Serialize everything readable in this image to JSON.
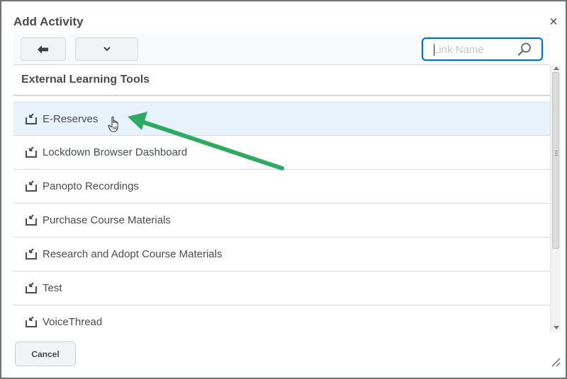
{
  "dialog": {
    "title": "Add Activity",
    "close_label": "×"
  },
  "toolbar": {
    "back_icon": "arrow-left-icon",
    "menu_icon": "chevron-down-icon",
    "search": {
      "placeholder": "Link Name",
      "value": "",
      "icon": "search-icon"
    }
  },
  "section": {
    "title": "External Learning Tools"
  },
  "items": [
    {
      "label": "E-Reserves",
      "icon": "external-link-icon",
      "selected": true
    },
    {
      "label": "Lockdown Browser Dashboard",
      "icon": "external-link-icon"
    },
    {
      "label": "Panopto Recordings",
      "icon": "external-link-icon"
    },
    {
      "label": "Purchase Course Materials",
      "icon": "external-link-icon"
    },
    {
      "label": "Research and Adopt Course Materials",
      "icon": "external-link-icon"
    },
    {
      "label": "Test",
      "icon": "external-link-icon"
    },
    {
      "label": "VoiceThread",
      "icon": "external-link-icon"
    }
  ],
  "footer": {
    "cancel_label": "Cancel"
  },
  "colors": {
    "accent": "#006fbf",
    "selected_row": "#e8f2fa",
    "annotation_arrow": "#2eaa63",
    "text": "#494c4e"
  }
}
